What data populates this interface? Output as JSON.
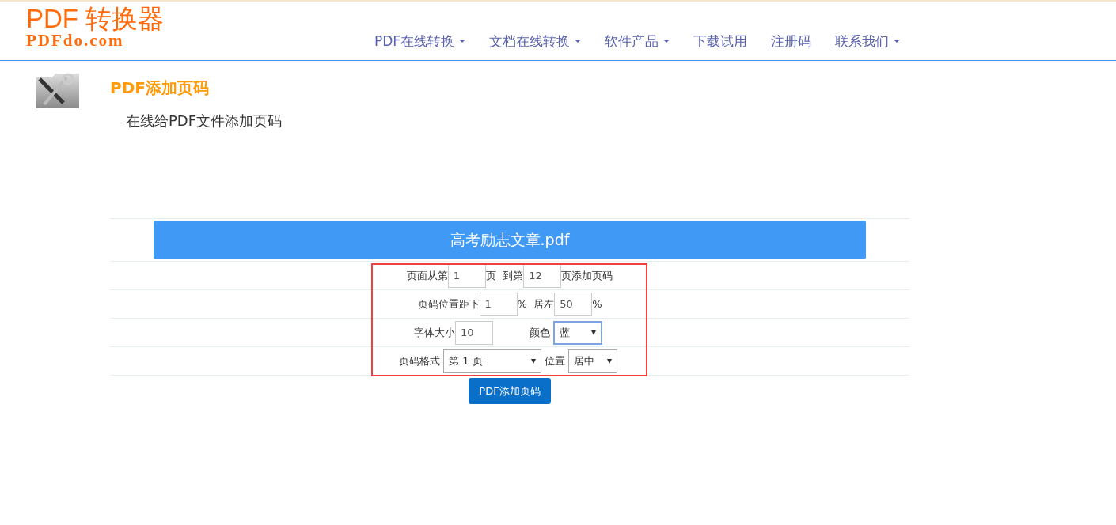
{
  "logo": {
    "title": "PDF 转换器",
    "domain": "PDFdo.com"
  },
  "nav": [
    {
      "label": "PDF在线转换",
      "dropdown": true
    },
    {
      "label": "文档在线转换",
      "dropdown": true
    },
    {
      "label": "软件产品",
      "dropdown": true
    },
    {
      "label": "下载试用",
      "dropdown": false
    },
    {
      "label": "注册码",
      "dropdown": false
    },
    {
      "label": "联系我们",
      "dropdown": true
    }
  ],
  "tool": {
    "title": "PDF添加页码",
    "description": "在线给PDF文件添加页码"
  },
  "file": {
    "name": "高考励志文章.pdf"
  },
  "form": {
    "highlighted": true,
    "rows": [
      {
        "items": [
          {
            "kind": "label",
            "text": "页面从第"
          },
          {
            "kind": "input",
            "value": "1"
          },
          {
            "kind": "label",
            "text": "页  到第"
          },
          {
            "kind": "input",
            "value": "12"
          },
          {
            "kind": "label",
            "text": "页添加页码"
          }
        ]
      },
      {
        "items": [
          {
            "kind": "label",
            "text": "页码位置距下"
          },
          {
            "kind": "input",
            "value": "1"
          },
          {
            "kind": "label",
            "text": "%  居左"
          },
          {
            "kind": "input",
            "value": "50"
          },
          {
            "kind": "label",
            "text": "%"
          }
        ]
      },
      {
        "items": [
          {
            "kind": "label",
            "text": "字体大小"
          },
          {
            "kind": "input",
            "value": "10"
          },
          {
            "kind": "gap"
          },
          {
            "kind": "label",
            "text": "颜色"
          },
          {
            "kind": "select",
            "value": "蓝",
            "focused": true
          }
        ]
      },
      {
        "items": [
          {
            "kind": "label",
            "text": "页码格式"
          },
          {
            "kind": "wide-select",
            "value": "第 1 页",
            "focused": false
          },
          {
            "kind": "label",
            "text": "位置"
          },
          {
            "kind": "select",
            "value": "居中",
            "focused": false
          }
        ]
      }
    ]
  },
  "submit": {
    "label": "PDF添加页码"
  }
}
